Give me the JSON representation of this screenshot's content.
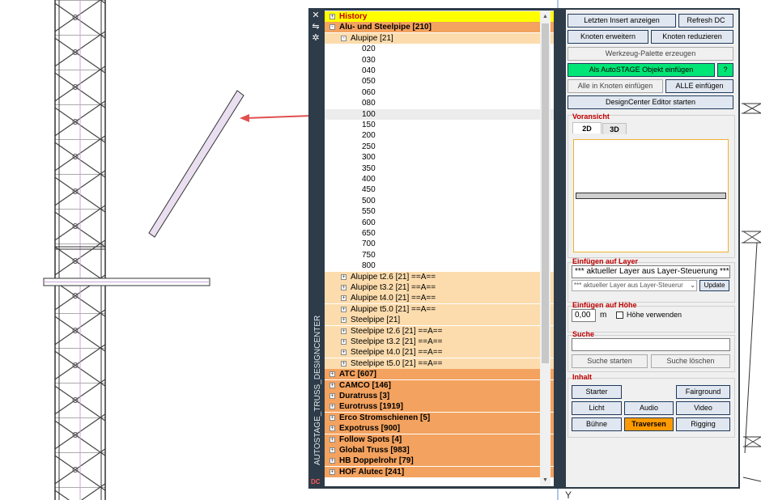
{
  "palette": {
    "title": "AUTOSTAGE_TRUSS_DESIGNCENTER",
    "mark": "DC"
  },
  "tree": {
    "rows": [
      {
        "label": "History",
        "level": 0,
        "style": "yellow",
        "expander": "+"
      },
      {
        "label": "Alu- und Steelpipe   [210]",
        "level": 0,
        "style": "orange",
        "expander": "-"
      },
      {
        "label": "Alupipe   [21]",
        "level": 1,
        "style": "light",
        "expander": "-"
      },
      {
        "label": "020",
        "level": 2,
        "style": "white"
      },
      {
        "label": "030",
        "level": 2,
        "style": "white"
      },
      {
        "label": "040",
        "level": 2,
        "style": "white"
      },
      {
        "label": "050",
        "level": 2,
        "style": "white"
      },
      {
        "label": "060",
        "level": 2,
        "style": "white"
      },
      {
        "label": "080",
        "level": 2,
        "style": "white"
      },
      {
        "label": "100",
        "level": 2,
        "style": "sel"
      },
      {
        "label": "150",
        "level": 2,
        "style": "white"
      },
      {
        "label": "200",
        "level": 2,
        "style": "white"
      },
      {
        "label": "250",
        "level": 2,
        "style": "white"
      },
      {
        "label": "300",
        "level": 2,
        "style": "white"
      },
      {
        "label": "350",
        "level": 2,
        "style": "white"
      },
      {
        "label": "400",
        "level": 2,
        "style": "white"
      },
      {
        "label": "450",
        "level": 2,
        "style": "white"
      },
      {
        "label": "500",
        "level": 2,
        "style": "white"
      },
      {
        "label": "550",
        "level": 2,
        "style": "white"
      },
      {
        "label": "600",
        "level": 2,
        "style": "white"
      },
      {
        "label": "650",
        "level": 2,
        "style": "white"
      },
      {
        "label": "700",
        "level": 2,
        "style": "white"
      },
      {
        "label": "750",
        "level": 2,
        "style": "white"
      },
      {
        "label": "800",
        "level": 2,
        "style": "white"
      },
      {
        "label": "Alupipe t2.6   [21]   ==A==",
        "level": 1,
        "style": "light",
        "expander": "+"
      },
      {
        "label": "Alupipe t3.2   [21]   ==A==",
        "level": 1,
        "style": "light",
        "expander": "+"
      },
      {
        "label": "Alupipe t4.0   [21]   ==A==",
        "level": 1,
        "style": "light",
        "expander": "+"
      },
      {
        "label": "Alupipe t5.0   [21]   ==A==",
        "level": 1,
        "style": "light",
        "expander": "+"
      },
      {
        "label": "Steelpipe   [21]",
        "level": 1,
        "style": "light",
        "expander": "+"
      },
      {
        "label": "Steelpipe t2.6   [21]   ==A==",
        "level": 1,
        "style": "light",
        "expander": "+"
      },
      {
        "label": "Steelpipe t3.2   [21]   ==A==",
        "level": 1,
        "style": "light",
        "expander": "+"
      },
      {
        "label": "Steelpipe t4.0   [21]   ==A==",
        "level": 1,
        "style": "light",
        "expander": "+"
      },
      {
        "label": "Steelpipe t5.0   [21]   ==A==",
        "level": 1,
        "style": "light",
        "expander": "+"
      },
      {
        "label": "ATC   [607]",
        "level": 0,
        "style": "orange",
        "expander": "+"
      },
      {
        "label": "CAMCO   [146]",
        "level": 0,
        "style": "orange",
        "expander": "+"
      },
      {
        "label": "Duratruss   [3]",
        "level": 0,
        "style": "orange",
        "expander": "+"
      },
      {
        "label": "Eurotruss   [1919]",
        "level": 0,
        "style": "orange",
        "expander": "+"
      },
      {
        "label": "Erco Stromschienen   [5]",
        "level": 0,
        "style": "orange",
        "expander": "+"
      },
      {
        "label": "Expotruss   [900]",
        "level": 0,
        "style": "orange",
        "expander": "+"
      },
      {
        "label": "Follow Spots   [4]",
        "level": 0,
        "style": "orange",
        "expander": "+"
      },
      {
        "label": "Global Truss   [983]",
        "level": 0,
        "style": "orange",
        "expander": "+"
      },
      {
        "label": "HB Doppelrohr   [79]",
        "level": 0,
        "style": "orange",
        "expander": "+"
      },
      {
        "label": "HOF Alutec   [241]",
        "level": 0,
        "style": "orange",
        "expander": "+"
      }
    ]
  },
  "buttons": {
    "last_insert": "Letzten Insert anzeigen",
    "refresh": "Refresh DC",
    "expand_nodes": "Knoten erweitern",
    "reduce_nodes": "Knoten reduzieren",
    "tool_palette": "Werkzeug-Palette erzeugen",
    "insert_object": "Als AutoSTAGE Objekt einfügen",
    "help": "?",
    "insert_all_in_node": "Alle in Knoten einfügen",
    "insert_all": "ALLE einfügen",
    "start_editor": "DesignCenter Editor starten"
  },
  "preview": {
    "label": "Voransicht",
    "tab_2d": "2D",
    "tab_3d": "3D"
  },
  "layer": {
    "label": "Einfügen auf Layer",
    "value": "*** aktueller Layer aus Layer-Steuerung ***",
    "combo_value": "*** aktueller Layer aus Layer-Steuerur",
    "update": "Update"
  },
  "height": {
    "label": "Einfügen auf Höhe",
    "value": "0,00",
    "unit": "m",
    "use_height": "Höhe verwenden"
  },
  "search": {
    "label": "Suche",
    "value": "",
    "start": "Suche starten",
    "clear": "Suche löschen"
  },
  "content": {
    "label": "Inhalt",
    "starter": "Starter",
    "fairground": "Fairground",
    "light": "Licht",
    "audio": "Audio",
    "video": "Video",
    "stage": "Bühne",
    "trusses": "Traversen",
    "rigging": "Rigging"
  },
  "colors": {
    "panel_frame": "#2e3b48",
    "history_bg": "#ffff00",
    "category_bg": "#f3a25f",
    "subcategory_bg": "#fcdcad",
    "accent_green": "#00e676",
    "accent_orange": "#ff9a00",
    "label_red": "#c00000"
  }
}
